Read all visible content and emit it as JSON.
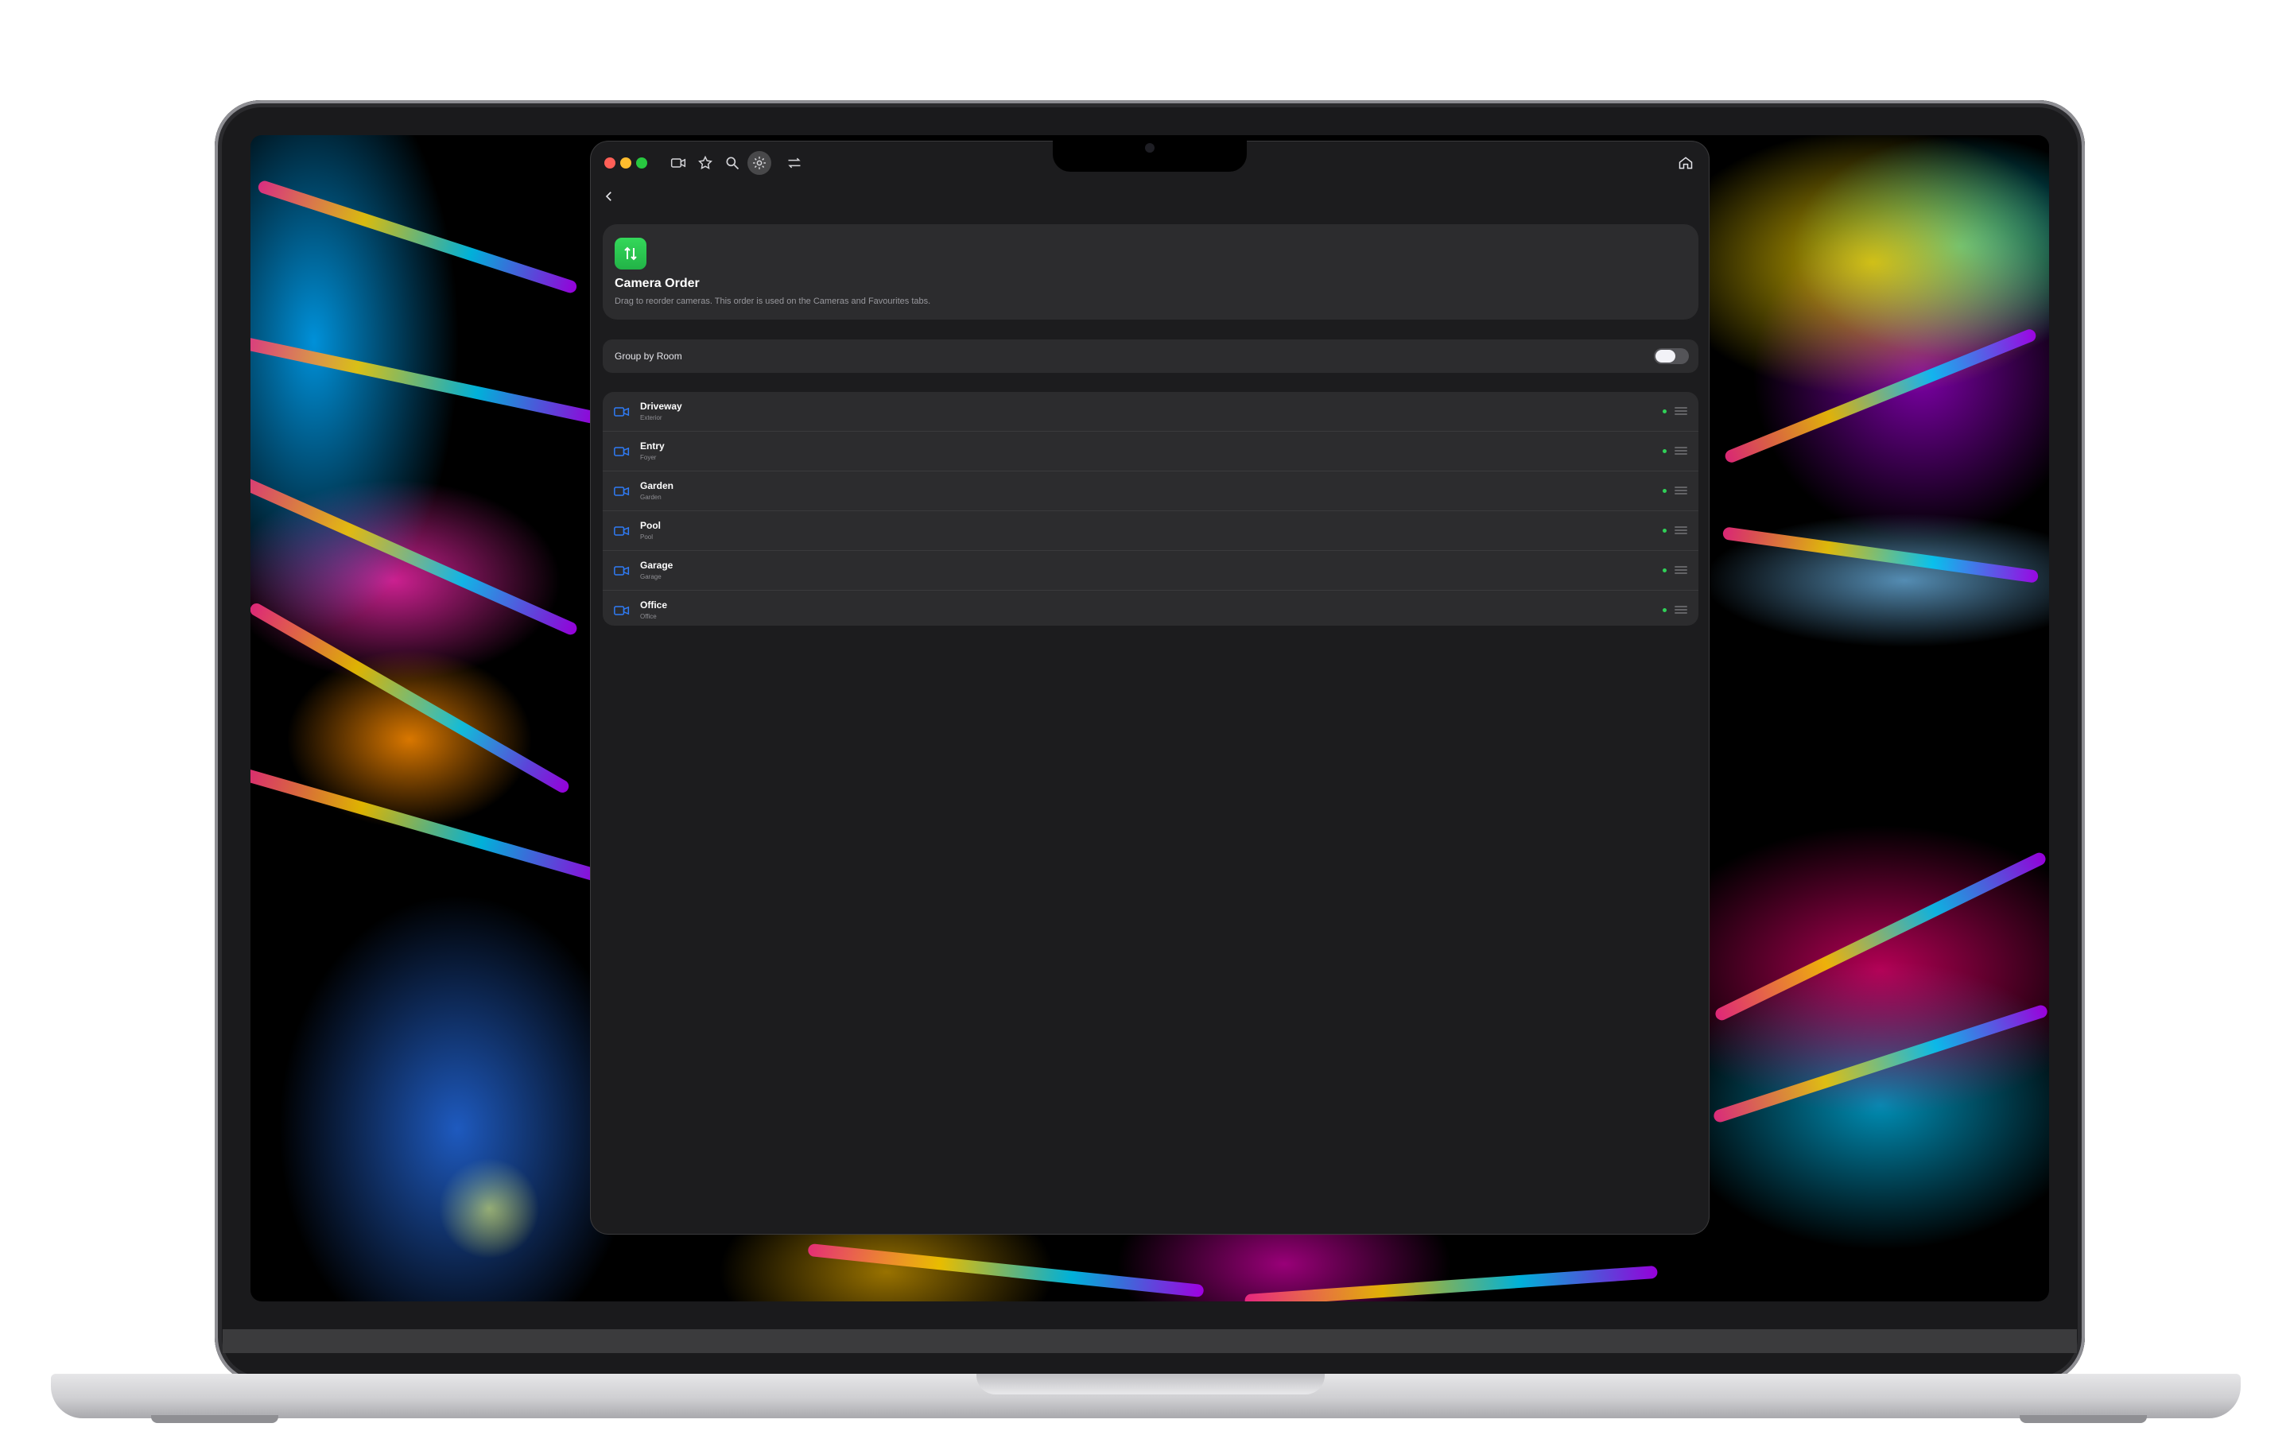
{
  "app": {
    "header": {
      "title": "Camera Order",
      "description": "Drag to reorder cameras. This order is used on the Cameras and Favourites tabs."
    },
    "group_by_room": {
      "label": "Group by Room",
      "enabled": false
    },
    "cameras": [
      {
        "name": "Driveway",
        "room": "Exterior",
        "status": "online"
      },
      {
        "name": "Entry",
        "room": "Foyer",
        "status": "online"
      },
      {
        "name": "Garden",
        "room": "Garden",
        "status": "online"
      },
      {
        "name": "Pool",
        "room": "Pool",
        "status": "online"
      },
      {
        "name": "Garage",
        "room": "Garage",
        "status": "online"
      },
      {
        "name": "Office",
        "room": "Office",
        "status": "online"
      }
    ]
  },
  "toolbar": {
    "icons": [
      "camera-icon",
      "star-icon",
      "search-icon",
      "gear-icon",
      "swap-icon"
    ],
    "active": "gear-icon"
  },
  "colors": {
    "accent_green": "#28c840",
    "camera_icon_blue": "#2f7bf5",
    "status_online": "#30d158"
  }
}
